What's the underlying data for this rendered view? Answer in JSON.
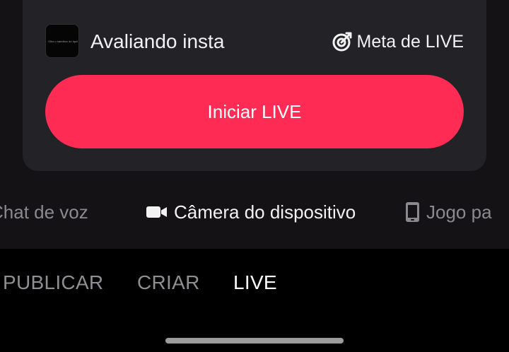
{
  "live_card": {
    "thumbnail_caption": "Olha o sandbox do Iquil",
    "account_name": "Avaliando insta",
    "goal_icon": "target-icon",
    "goal_label": "Meta de LIVE",
    "start_button_label": "Iniciar LIVE",
    "start_button_color": "#fe2c55"
  },
  "modes": [
    {
      "label": "Chat de voz",
      "icon": "none",
      "selected": false
    },
    {
      "label": "Câmera do dispositivo",
      "icon": "video-camera-icon",
      "selected": true
    },
    {
      "label": "Jogo pa",
      "icon": "phone-icon",
      "selected": false
    }
  ],
  "bottom_tabs": [
    {
      "label": "PUBLICAR",
      "selected": false
    },
    {
      "label": "CRIAR",
      "selected": false
    },
    {
      "label": "LIVE",
      "selected": true
    }
  ]
}
